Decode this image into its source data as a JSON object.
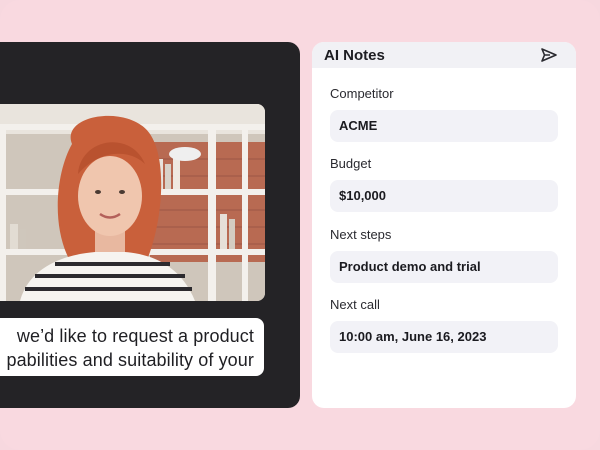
{
  "caption": {
    "line1": "we’d like to request a product",
    "line2": "pabilities and suitability of your"
  },
  "notes": {
    "title": "AI Notes",
    "send_icon": "send-icon",
    "fields": [
      {
        "label": "Competitor",
        "value": "ACME"
      },
      {
        "label": "Budget",
        "value": "$10,000"
      },
      {
        "label": "Next steps",
        "value": "Product demo and trial"
      },
      {
        "label": "Next call",
        "value": "10:00 am, June 16, 2023"
      }
    ]
  },
  "colors": {
    "background": "#f9d9e0",
    "video_panel": "#242326",
    "field_fill": "#f2f2f7"
  }
}
